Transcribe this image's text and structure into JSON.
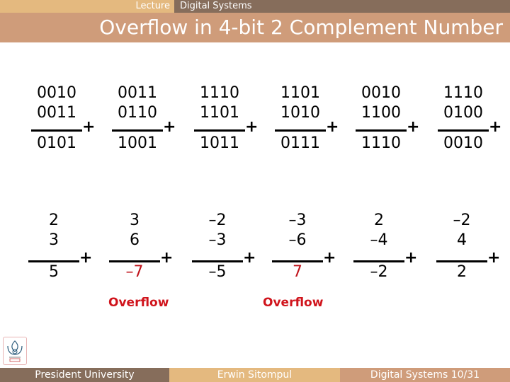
{
  "header": {
    "left_label": "Lecture",
    "right_label": "Digital Systems",
    "title": "Overflow in 4-bit 2 Complement Number"
  },
  "binary_problems": [
    {
      "a": "0010",
      "b": "0011",
      "sum": "0101",
      "operator": "+"
    },
    {
      "a": "0011",
      "b": "0110",
      "sum": "1001",
      "operator": "+"
    },
    {
      "a": "1110",
      "b": "1101",
      "sum": "1011",
      "operator": "+"
    },
    {
      "a": "1101",
      "b": "1010",
      "sum": "0111",
      "operator": "+"
    },
    {
      "a": "0010",
      "b": "1100",
      "sum": "1110",
      "operator": "+"
    },
    {
      "a": "1110",
      "b": "0100",
      "sum": "0010",
      "operator": "+"
    }
  ],
  "decimal_problems": [
    {
      "a": "2",
      "b": "3",
      "sum": "5",
      "operator": "+",
      "overflow": false
    },
    {
      "a": "3",
      "b": "6",
      "sum": "–7",
      "operator": "+",
      "overflow": true
    },
    {
      "a": "–2",
      "b": "–3",
      "sum": "–5",
      "operator": "+",
      "overflow": false
    },
    {
      "a": "–3",
      "b": "–6",
      "sum": "7",
      "operator": "+",
      "overflow": true
    },
    {
      "a": "2",
      "b": "–4",
      "sum": "–2",
      "operator": "+",
      "overflow": false
    },
    {
      "a": "–2",
      "b": "4",
      "sum": "2",
      "operator": "+",
      "overflow": false
    }
  ],
  "overflow_labels": [
    "Overflow",
    "Overflow"
  ],
  "colors": {
    "tan": "#e4b97f",
    "brown": "#866d5b",
    "salmon": "#cf9c7a",
    "overflow_red": "#d0141c"
  },
  "logo": {
    "icon": "university-logo-icon"
  },
  "footer": {
    "institution": "President University",
    "author": "Erwin Sitompul",
    "course_page": "Digital Systems 10/31"
  }
}
